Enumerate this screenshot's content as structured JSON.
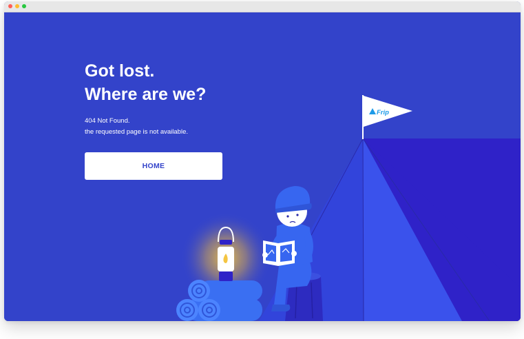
{
  "error_page": {
    "headline_line1": "Got lost.",
    "headline_line2": "Where are we?",
    "status_line": "404 Not Found.",
    "description_line": "the requested page is not available.",
    "home_button_label": "HOME"
  },
  "flag": {
    "brand_label": "Frip"
  },
  "colors": {
    "background": "#3343ca",
    "tent_right": "#2f22c8",
    "tent_left": "#3040d8",
    "button_bg": "#ffffff",
    "button_text": "#3343ca",
    "character_blue": "#3766f0",
    "brand_accent": "#1e9be8"
  }
}
